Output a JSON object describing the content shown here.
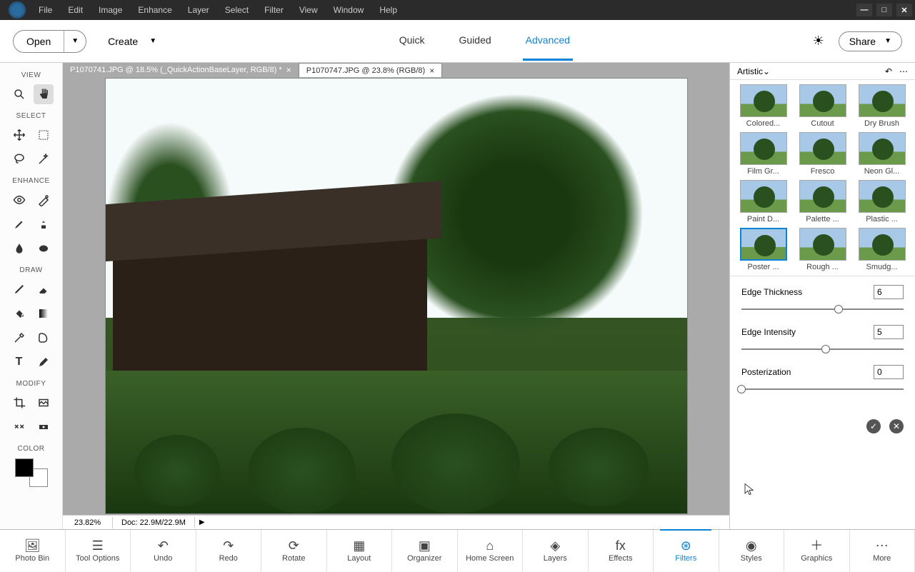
{
  "menu": [
    "File",
    "Edit",
    "Image",
    "Enhance",
    "Layer",
    "Select",
    "Filter",
    "View",
    "Window",
    "Help"
  ],
  "topbar": {
    "open": "Open",
    "create": "Create",
    "modes": [
      "Quick",
      "Guided",
      "Advanced"
    ],
    "active_mode": "Advanced",
    "share": "Share"
  },
  "toolbar": {
    "sections": [
      "VIEW",
      "SELECT",
      "ENHANCE",
      "DRAW",
      "MODIFY",
      "COLOR"
    ]
  },
  "tabs": [
    {
      "label": "P1070741.JPG @ 18.5% (_QuickActionBaseLayer, RGB/8) *",
      "active": false
    },
    {
      "label": "P1070747.JPG @ 23.8% (RGB/8)",
      "active": true
    }
  ],
  "status": {
    "zoom": "23.82%",
    "doc": "Doc: 22.9M/22.9M"
  },
  "panel": {
    "category": "Artistic",
    "filters": [
      "Colored...",
      "Cutout",
      "Dry Brush",
      "Film Gr...",
      "Fresco",
      "Neon Gl...",
      "Paint D...",
      "Palette ...",
      "Plastic ...",
      "Poster ...",
      "Rough ...",
      "Smudg..."
    ],
    "selected": "Poster ...",
    "controls": [
      {
        "label": "Edge Thickness",
        "value": "6",
        "pos": 60
      },
      {
        "label": "Edge Intensity",
        "value": "5",
        "pos": 52
      },
      {
        "label": "Posterization",
        "value": "0",
        "pos": 0
      }
    ]
  },
  "dock": [
    "Photo Bin",
    "Tool Options",
    "Undo",
    "Redo",
    "Rotate",
    "Layout",
    "Organizer",
    "Home Screen",
    "Layers",
    "Effects",
    "Filters",
    "Styles",
    "Graphics",
    "More"
  ],
  "dock_active": "Filters"
}
